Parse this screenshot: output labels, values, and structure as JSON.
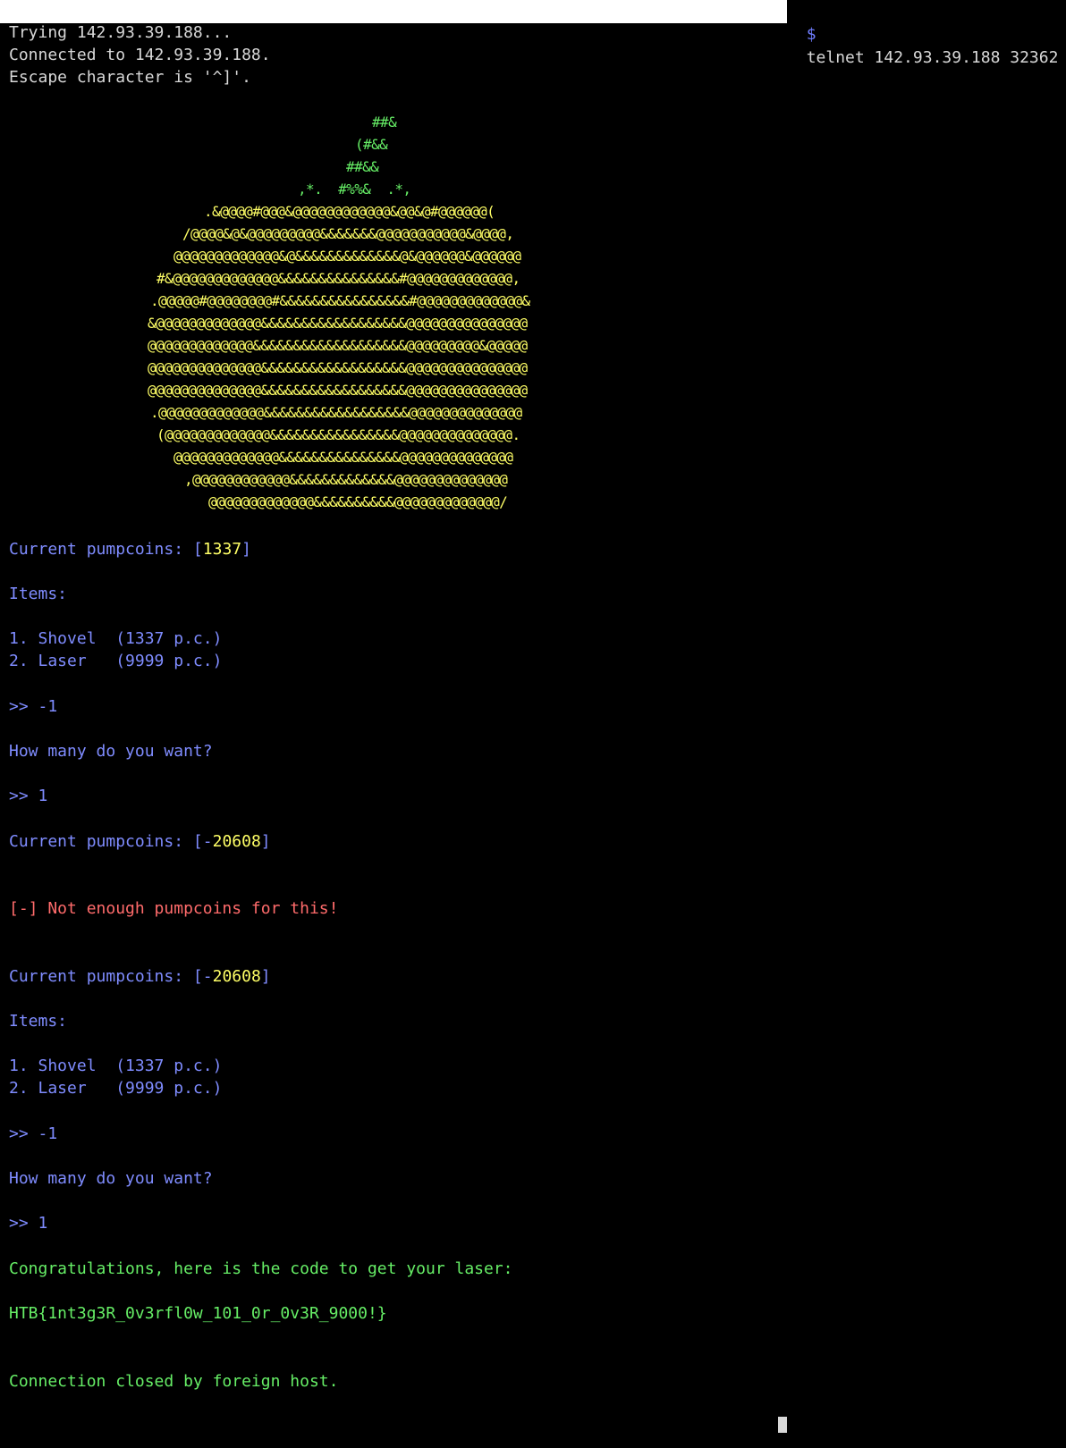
{
  "colors": {
    "background": "#000000",
    "plain_text": "#d8d8d8",
    "menu_text": "#7f8cff",
    "highlight_value": "#ffff66",
    "success_text": "#66ee66",
    "error_text": "#ff6b6b"
  },
  "command": {
    "prompt_symbol": "$",
    "text": "telnet 142.93.39.188 32362"
  },
  "connection": {
    "trying": "Trying 142.93.39.188...",
    "connected": "Connected to 142.93.39.188.",
    "escape": "Escape character is '^]'."
  },
  "ascii_art": {
    "stem": [
      "##&",
      "(#&&",
      "##&&",
      ",*.  #%%&  .*,"
    ],
    "body": [
      ".&@@@@#@@@&@@@@@@@@@@@@&@@&@#@@@@@@(",
      "/@@@@&@&@@@@@@@@@&&&&&&&@@@@@@@@@@@&@@@@,",
      "@@@@@@@@@@@@@&@&&&&&&&&&&&&&@&@@@@@@&@@@@@@",
      "#&@@@@@@@@@@@@@&&&&&&&&&&&&&&&#@@@@@@@@@@@@@,",
      ".@@@@@#@@@@@@@@#&&&&&&&&&&&&&&&&#@@@@@@@@@@@@@&",
      "&@@@@@@@@@@@@@&&&&&&&&&&&&&&&&&&@@@@@@@@@@@@@@@",
      "@@@@@@@@@@@@@&&&&&&&&&&&&&&&&&&&@@@@@@@@@&@@@@@",
      "@@@@@@@@@@@@@@&&&&&&&&&&&&&&&&&&@@@@@@@@@@@@@@@",
      "@@@@@@@@@@@@@@&&&&&&&&&&&&&&&&&&@@@@@@@@@@@@@@@",
      ".@@@@@@@@@@@@@&&&&&&&&&&&&&&&&&&@@@@@@@@@@@@@@",
      "(@@@@@@@@@@@@@&&&&&&&&&&&&&&&&@@@@@@@@@@@@@@.",
      "@@@@@@@@@@@@@&&&&&&&&&&&&&&&@@@@@@@@@@@@@@",
      ",@@@@@@@@@@@@&&&&&&&&&&&&&@@@@@@@@@@@@@@",
      "@@@@@@@@@@@@@&&&&&&&&&&@@@@@@@@@@@@@/"
    ]
  },
  "session1": {
    "coins_label": "Current pumpcoins:",
    "coins_open": "[",
    "coins_value": "1337",
    "coins_close": "]",
    "items_heading": "Items:",
    "item1": "1. Shovel  (1337 p.c.)",
    "item2": "2. Laser   (9999 p.c.)",
    "input1": ">> -1",
    "quantity_question": "How many do you want?",
    "input2": ">> 1",
    "coins_after_label": "Current pumpcoins:",
    "coins_after_open": "[-",
    "coins_after_value": "20608",
    "coins_after_close": "]",
    "error_message": "[-] Not enough pumpcoins for this!"
  },
  "session2": {
    "coins_label": "Current pumpcoins:",
    "coins_open": "[-",
    "coins_value": "20608",
    "coins_close": "]",
    "items_heading": "Items:",
    "item1": "1. Shovel  (1337 p.c.)",
    "item2": "2. Laser   (9999 p.c.)",
    "input1": ">> -1",
    "quantity_question": "How many do you want?",
    "input2": ">> 1",
    "congrats": "Congratulations, here is the code to get your laser:",
    "flag": "HTB{1nt3g3R_0v3rfl0w_101_0r_0v3R_9000!}"
  },
  "footer": {
    "closed": "Connection closed by foreign host."
  }
}
